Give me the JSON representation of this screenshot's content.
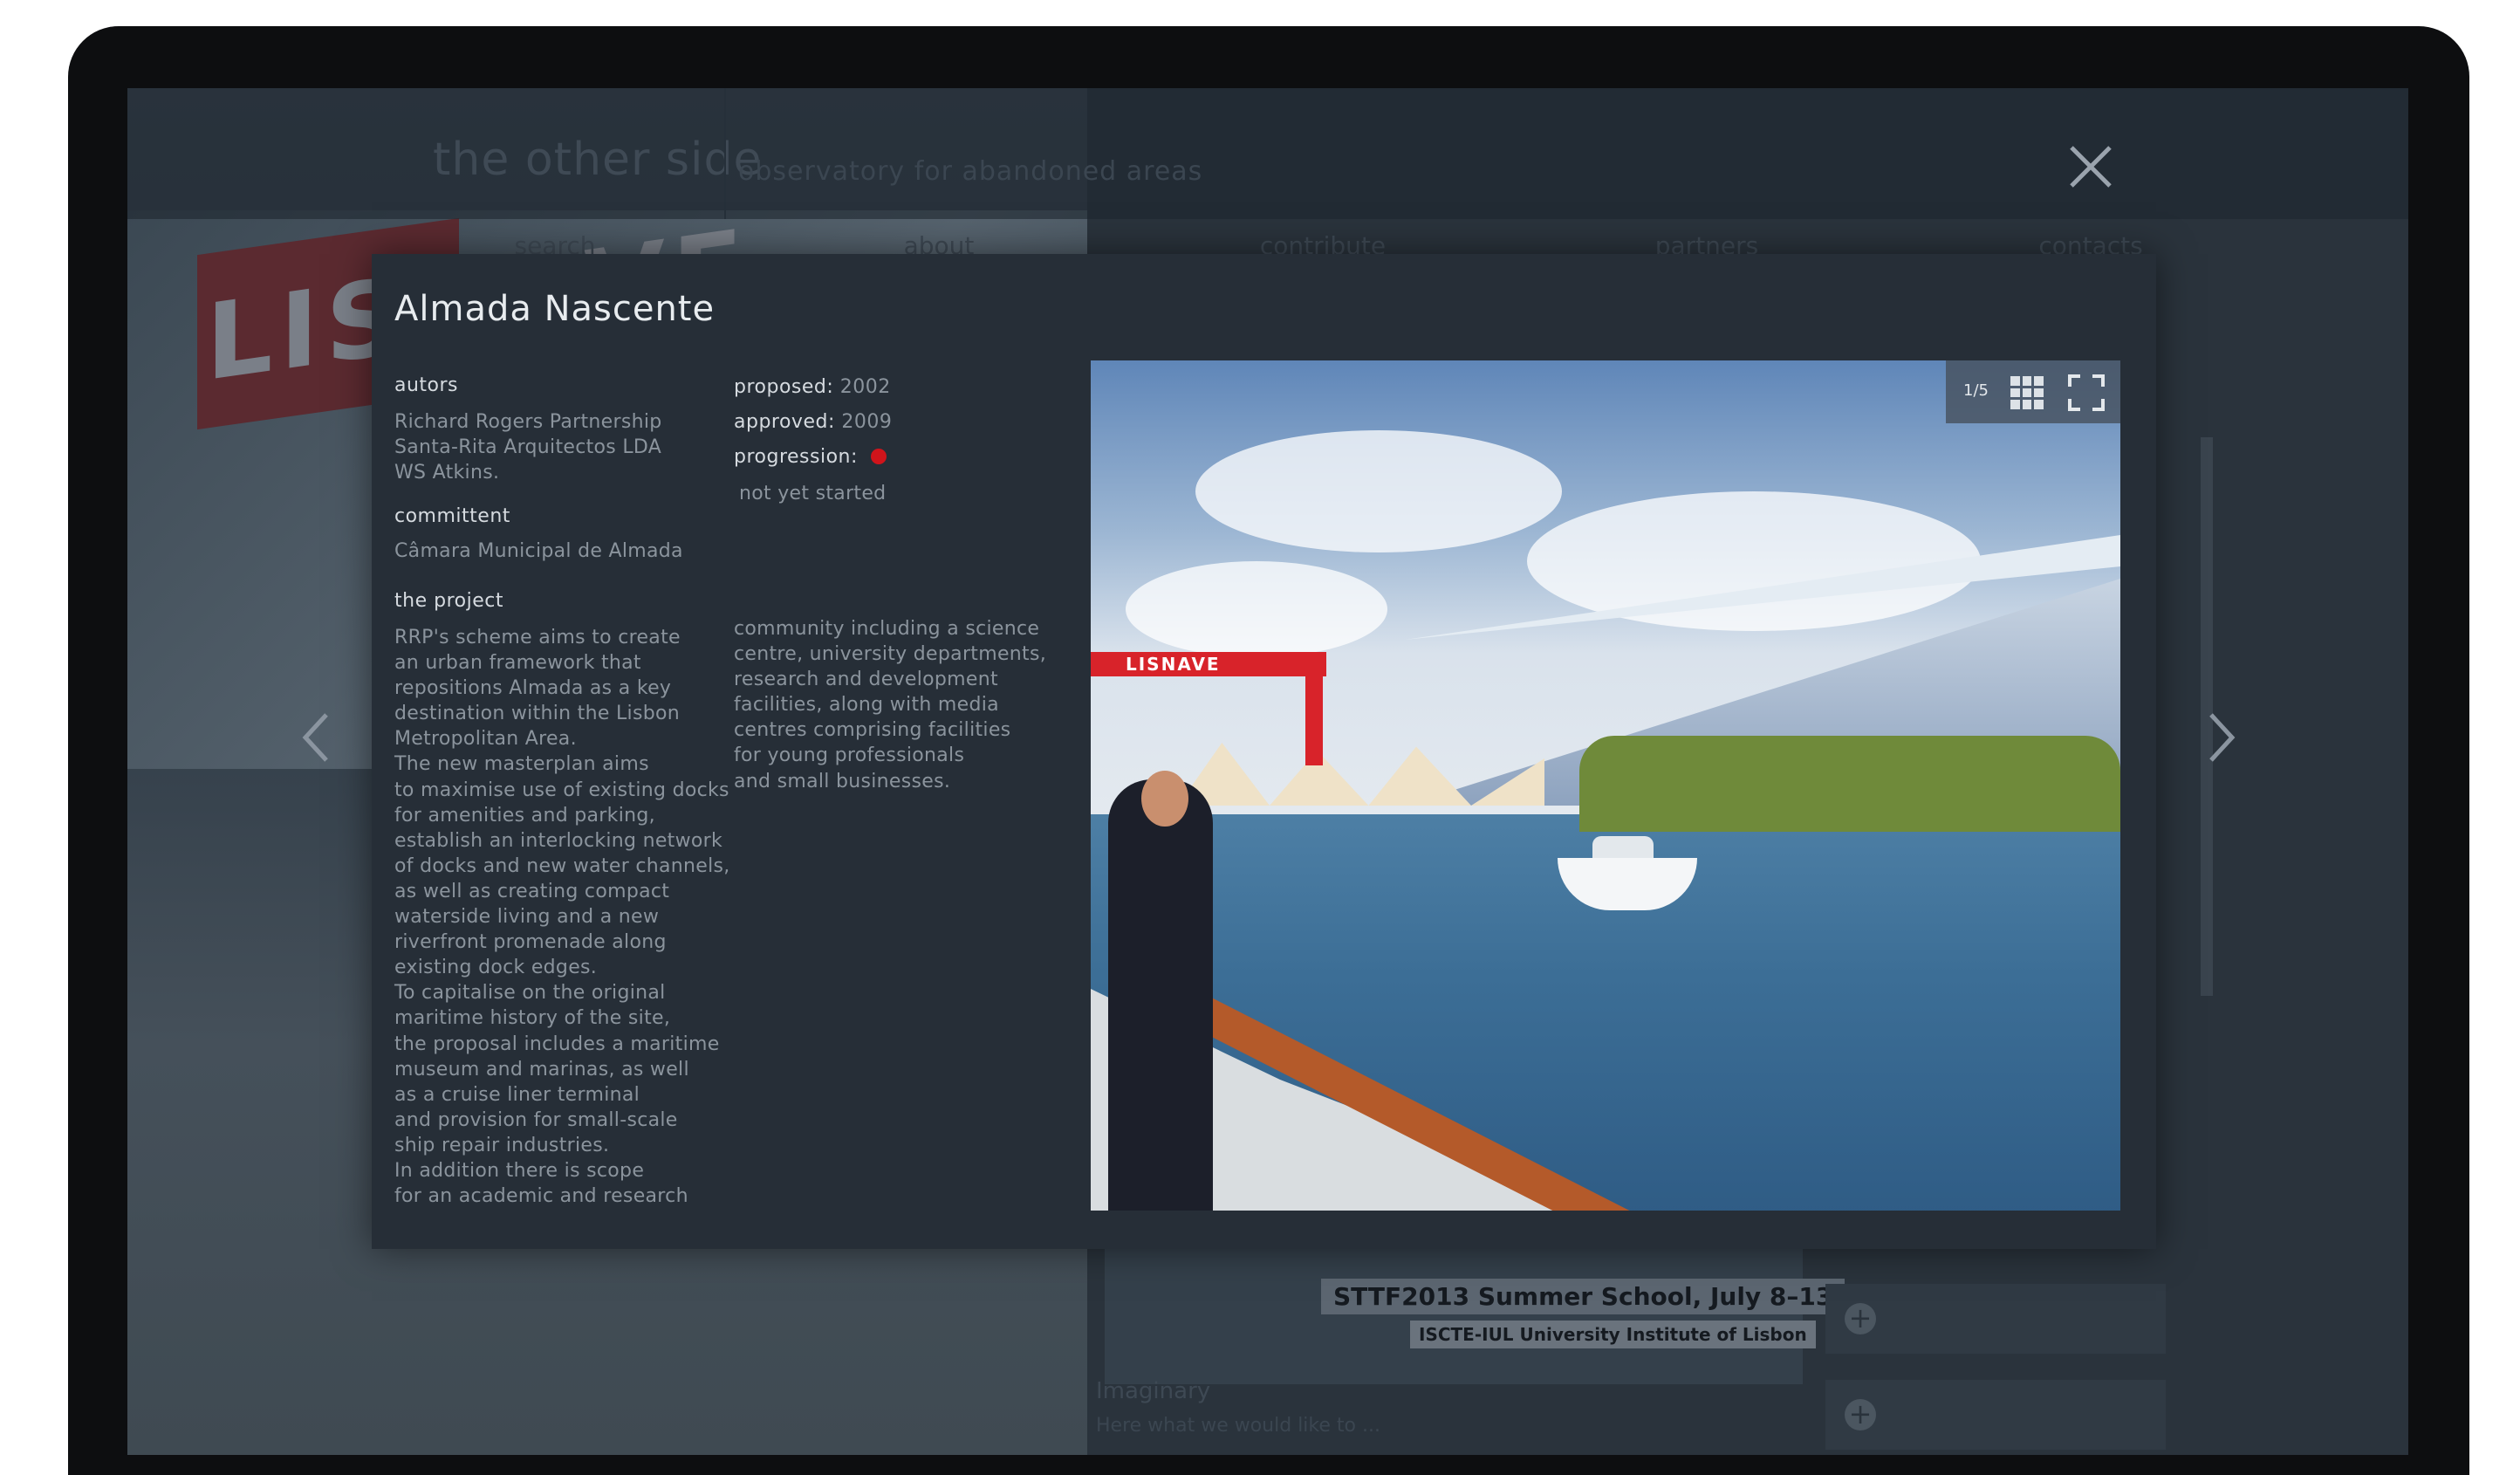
{
  "site": {
    "brand": "the other side",
    "tagline": "observatory for abandoned areas",
    "nav": [
      "search",
      "about",
      "contribute",
      "partners",
      "contacts"
    ],
    "background_sign": "LISNAVE",
    "card_title": "STTF2013 Summer School, July 8–13",
    "card_subtitle": "ISCTE-IUL University Institute of Lisbon",
    "imaginary_label": "Imaginary",
    "imaginary_sub": "Here what we would like to ..."
  },
  "modal": {
    "title": "Almada Nascente",
    "autors_label": "autors",
    "autors": [
      "Richard Rogers Partnership",
      "Santa-Rita Arquitectos LDA",
      "WS Atkins."
    ],
    "committent_label": "committent",
    "committent": "Câmara Municipal de Almada",
    "project_label": "the project",
    "proposed_label": "proposed:",
    "proposed": "2002",
    "approved_label": "approved:",
    "approved": "2009",
    "progression_label": "progression:",
    "progression_status": "not yet started",
    "progression_color": "#d0141b",
    "project_text_col1": "RRP's scheme aims to create\nan urban framework that\nrepositions Almada as a key\ndestination within the Lisbon\nMetropolitan Area.\nThe new masterplan aims\nto maximise use of existing docks\nfor amenities and parking,\nestablish an interlocking network\nof docks and new water channels,\nas well as creating compact\nwaterside living and a new\nriverfront promenade along\nexisting dock edges.\nTo capitalise on the original\nmaritime history of the site,\nthe proposal includes a maritime\nmuseum and marinas, as well\nas a cruise liner terminal\nand provision for small-scale\nship repair industries.\nIn addition there is scope\nfor an academic and research",
    "project_text_col2": "community including a science\ncentre, university departments,\nresearch and development\nfacilities, along with media\ncentres comprising facilities\nfor young professionals\nand small businesses."
  },
  "gallery": {
    "counter": "1/5",
    "image_sign": "LISNAVE",
    "grid_icon": "grid-icon",
    "fullscreen_icon": "fullscreen-icon"
  },
  "controls": {
    "prev_icon": "chevron-left-icon",
    "next_icon": "chevron-right-icon",
    "close_icon": "close-icon"
  }
}
